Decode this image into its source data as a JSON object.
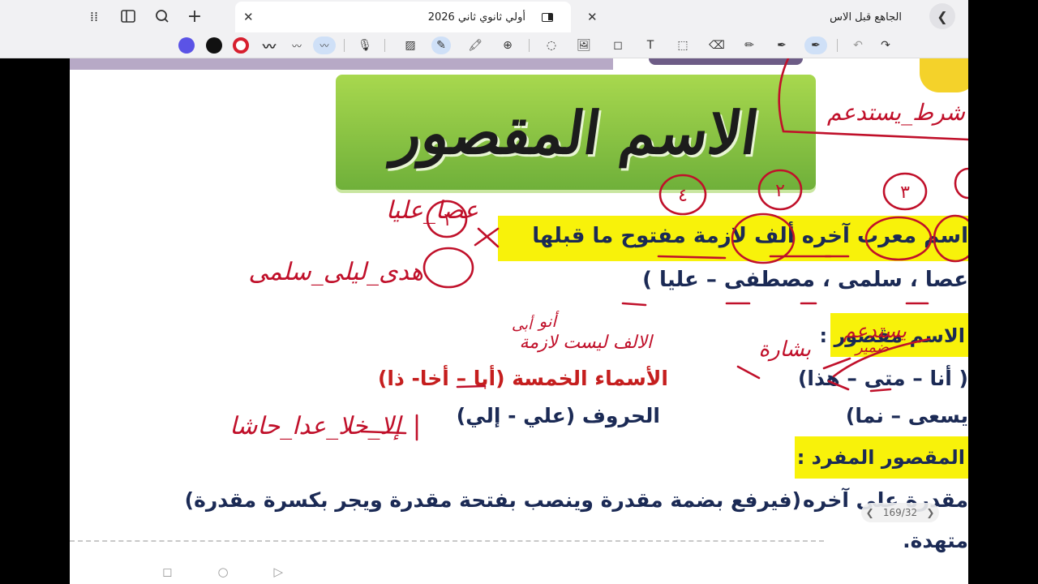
{
  "tabs": {
    "active_title": "أولي ثانوي  ثاني 2026",
    "inactive_title": "الجاهع قبل الاس"
  },
  "icons": {
    "apps": "apps-grid-icon",
    "sidebar": "sidebar-icon",
    "search": "search-icon",
    "add": "plus-icon"
  },
  "toolbar": {
    "colors": [
      "#5b53e6",
      "#111111",
      "#d71f2e"
    ]
  },
  "slide": {
    "title": "الاسم المقصور",
    "definition": "اسم معرب آخره ألف لازمة مفتوح ما قبلها",
    "examples": "عصا ، سلمى ، مصطفى – عليا )",
    "not_maqsur_heading": "الاسم مقصور :",
    "five_nouns": "الأسماء الخمسة (أبا – أخا- ذا)",
    "not_list": "( أنا – متى – هذا)",
    "letters": "الحروف (علي - إلي)",
    "verbs": "يسعى – نما)",
    "singular_heading": "المقصور المفرد :",
    "rule_line_right": "مقدرة على آخره",
    "rule_line_left": "(فيرفع بضمة مقدرة وينصب بفتحة مقدرة  ويجر بكسرة مقدرة)",
    "last_line": "متهدة."
  },
  "annotations": {
    "a1": "عصا_عليا",
    "a2": "هدى_ليلى_سلمى",
    "a3": "الالف ليست لازمة",
    "a4": "إلا_خلا_عدا_حاشا",
    "a5": "شرط_يستدعم",
    "a6": "بشارة",
    "a7": "يستدعم",
    "a8": "ضمير",
    "a9": "أنو",
    "a10": "أبى",
    "n1": "١",
    "n2": "٢",
    "n3": "٣",
    "n4": "٤"
  },
  "pager": {
    "current": "169/32"
  }
}
